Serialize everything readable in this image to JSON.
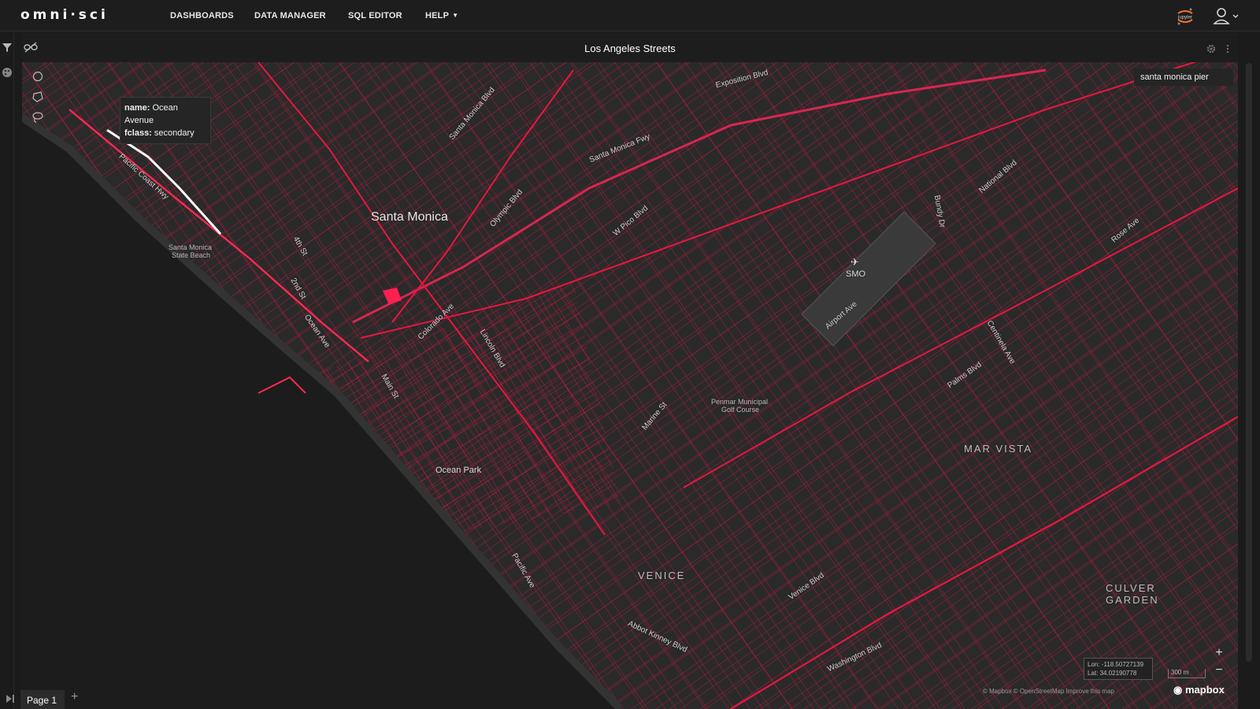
{
  "app": {
    "logo_text": "omni·sci"
  },
  "nav": {
    "items": [
      {
        "label": "DASHBOARDS"
      },
      {
        "label": "DATA MANAGER"
      },
      {
        "label": "SQL EDITOR"
      },
      {
        "label": "HELP"
      }
    ],
    "jupyter_label": "jupyter"
  },
  "dashboard": {
    "title": "Los Angeles Streets"
  },
  "map": {
    "street_color": "#e8173f",
    "background_color": "#2a2a2a",
    "ocean_color": "#1c1c1c",
    "search_value": "santa monica pier",
    "tooltip": {
      "name_key": "name:",
      "name_value": "Ocean Avenue",
      "fclass_key": "fclass:",
      "fclass_value": "secondary"
    },
    "places": {
      "santa_monica": "Santa Monica",
      "venice": "VENICE",
      "mar_vista": "MAR VISTA",
      "culver_garden_1": "CULVER",
      "culver_garden_2": "GARDEN",
      "ocean_park": "Ocean Park",
      "smo": "SMO",
      "sm_beach_1": "Santa Monica",
      "sm_beach_2": "State Beach",
      "golf_1": "Penmar Municipal",
      "golf_2": "Golf Course"
    },
    "streets": [
      "Pacific Coast Hwy",
      "Santa Monica Fwy",
      "Olympic Blvd",
      "Santa Monica Blvd",
      "Lincoln Blvd",
      "W Pico Blvd",
      "Ocean Ave",
      "Main St",
      "Venice Blvd",
      "Abbot Kinney Blvd",
      "Exposition Blvd",
      "National Blvd",
      "Rose Ave",
      "Palms Blvd",
      "Washington Blvd",
      "Airport Ave",
      "Bundy Dr",
      "Centinela Ave",
      "Marine St",
      "Pacific Ave",
      "4th St",
      "2nd St",
      "Colorado Ave"
    ],
    "coords": {
      "lon": "Lon: -118.50727139",
      "lat": "Lat: 34.02190778"
    },
    "scale": "300 m",
    "attribution": "© Mapbox © OpenStreetMap Improve this map",
    "mapbox_label": "mapbox"
  },
  "pages": {
    "current": "Page 1"
  }
}
